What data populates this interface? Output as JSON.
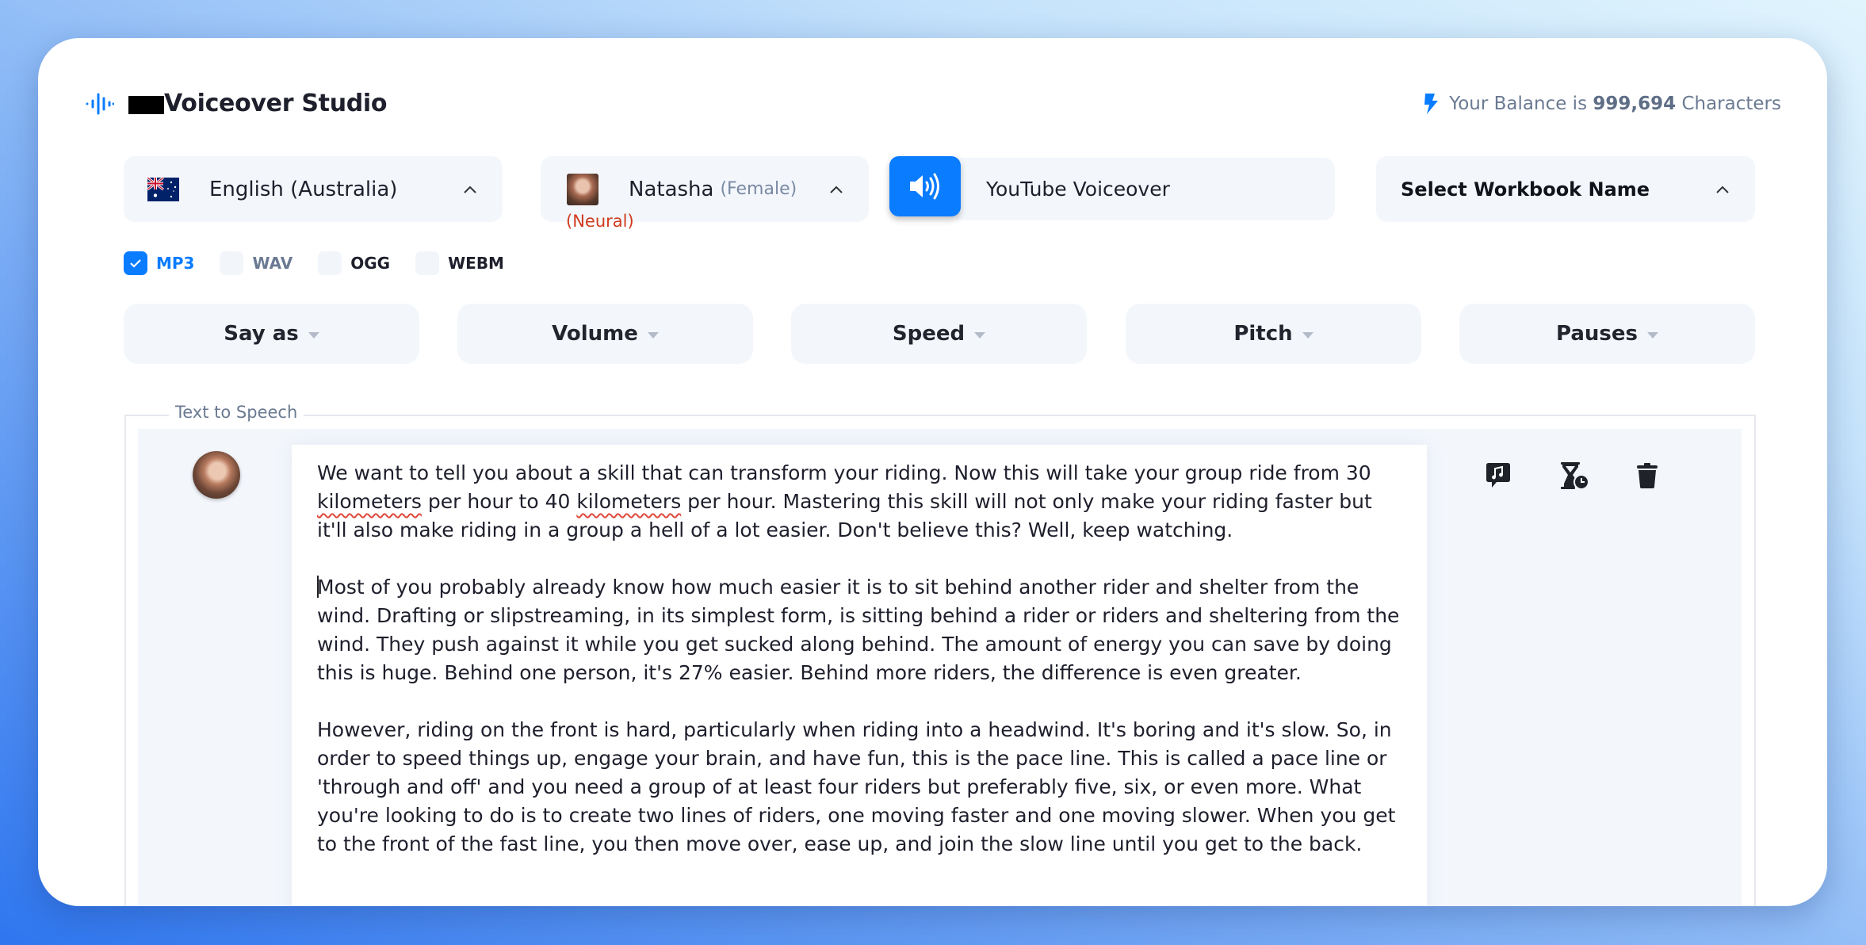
{
  "header": {
    "app_title": "Voiceover Studio",
    "balance_prefix": "Your Balance is",
    "balance_value": "999,694",
    "balance_suffix": "Characters",
    "logo_icon": "sound-wave-icon",
    "balance_icon": "lightning-bolt-icon"
  },
  "selectors": {
    "language": {
      "label": "English (Australia)",
      "icon": "australia-flag-icon"
    },
    "voice": {
      "name": "Natasha",
      "gender": "(Female)",
      "type": "(Neural)"
    },
    "title_input": {
      "value": "YouTube Voiceover",
      "icon": "speaker-icon"
    },
    "workbook": {
      "label": "Select Workbook Name"
    }
  },
  "formats": [
    {
      "label": "MP3",
      "checked": true,
      "color": "#0a7cff"
    },
    {
      "label": "WAV",
      "checked": false,
      "color": "#6b7a93"
    },
    {
      "label": "OGG",
      "checked": false,
      "color": "#1e1f2c"
    },
    {
      "label": "WEBM",
      "checked": false,
      "color": "#1e1f2c"
    }
  ],
  "controls": [
    {
      "label": "Say as"
    },
    {
      "label": "Volume"
    },
    {
      "label": "Speed"
    },
    {
      "label": "Pitch"
    },
    {
      "label": "Pauses"
    }
  ],
  "editor": {
    "section_label": "Text to Speech",
    "p1_a": "We want to tell you about a skill that can transform your riding. Now this will take your group ride from 30 ",
    "p1_w1": "kilometers",
    "p1_b": " per hour to 40 ",
    "p1_w2": "kilometers",
    "p1_c": " per hour. Mastering this skill will not only make your riding faster but it'll also make riding in a group a hell of a lot easier. Don't believe this? Well, keep watching.",
    "p2": "Most of you probably already know how much easier it is to sit behind another rider and shelter from the wind. Drafting or slipstreaming, in its simplest form, is sitting behind a rider or riders and sheltering from the wind. They push against it while you get sucked along behind. The amount of energy you can save by doing this is huge. Behind one person, it's 27% easier. Behind more riders, the difference is even greater.",
    "p3": "However, riding on the front is hard, particularly when riding into a headwind. It's boring and it's slow. So, in order to speed things up, engage your brain, and have fun, this is the pace line. This is called a pace line or 'through and off' and you need a group of at least four riders but preferably five, six, or even more. What you're looking to do is to create two lines of riders, one moving faster and one moving slower. When you get to the front of the fast line, you then move over, ease up, and join the slow line until you get to the back.",
    "tools": [
      "speech-music-icon",
      "hourglass-clock-icon",
      "trash-icon"
    ]
  },
  "colors": {
    "accent": "#0a7cff",
    "panel": "#f3f7fc",
    "error": "#d13a1c"
  }
}
